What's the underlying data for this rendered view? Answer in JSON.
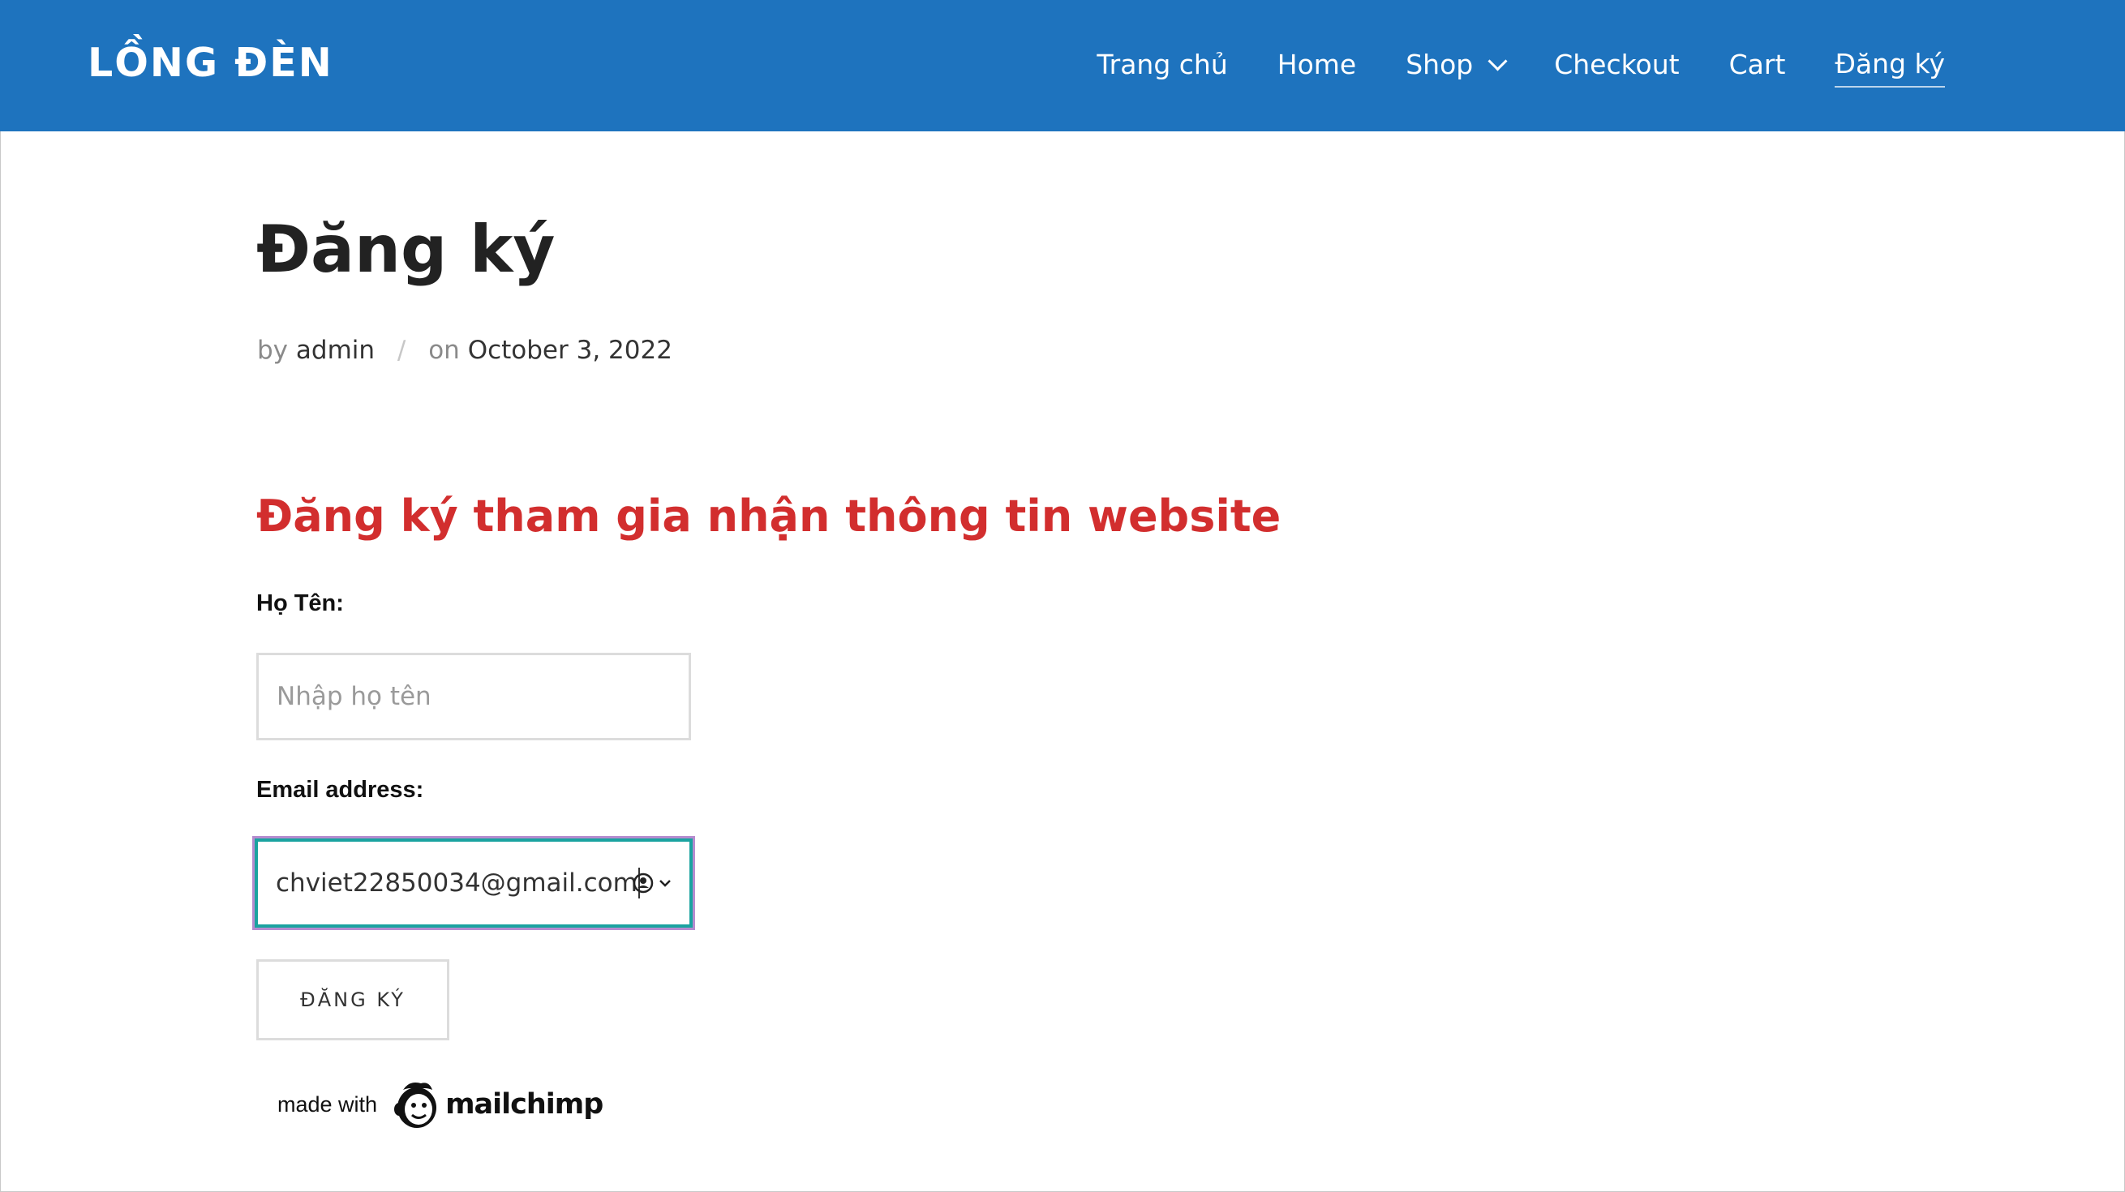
{
  "site": {
    "title": "LỒNG ĐÈN"
  },
  "nav": {
    "items": [
      {
        "label": "Trang chủ"
      },
      {
        "label": "Home"
      },
      {
        "label": "Shop"
      },
      {
        "label": "Checkout"
      },
      {
        "label": "Cart"
      },
      {
        "label": "Đăng ký"
      }
    ]
  },
  "page": {
    "title": "Đăng ký",
    "meta": {
      "by": "by",
      "author": "admin",
      "on": "on",
      "date": "October 3, 2022",
      "separator": "/"
    }
  },
  "form": {
    "heading": "Đăng ký tham gia nhận thông tin website",
    "name_label": "Họ Tên:",
    "name_placeholder": "Nhập họ tên",
    "email_label": "Email address:",
    "email_value": "chviet22850034@gmail.com",
    "submit_label": "ĐĂNG KÝ"
  },
  "footer_badge": {
    "made_with": "made with",
    "brand": "mailchimp"
  },
  "colors": {
    "header_bg": "#1e73be",
    "heading_red": "#d22e2e",
    "focus_border": "#1aa3a0"
  }
}
